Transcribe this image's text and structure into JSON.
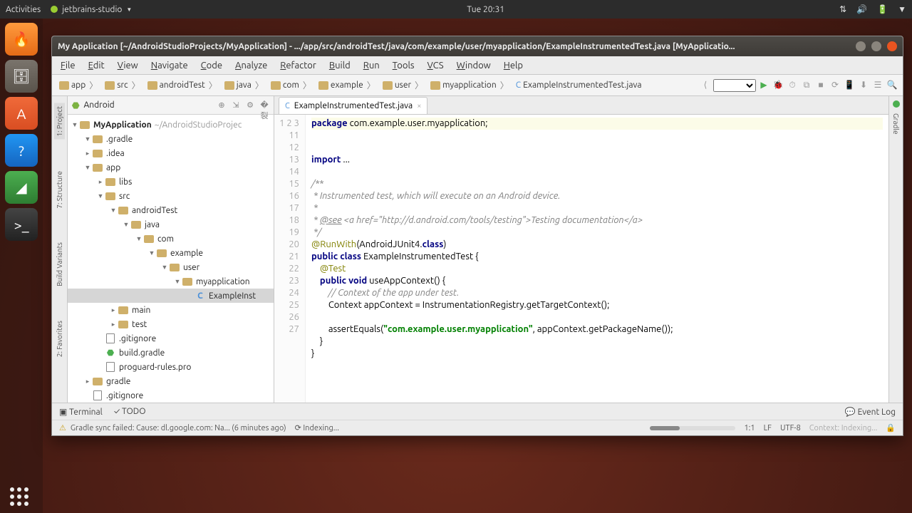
{
  "ubuntu": {
    "activities": "Activities",
    "app": "jetbrains-studio",
    "clock": "Tue 20:31"
  },
  "ide": {
    "title": "My Application [~/AndroidStudioProjects/MyApplication] - .../app/src/androidTest/java/com/example/user/myapplication/ExampleInstrumentedTest.java [MyApplicatio...",
    "menu": [
      "File",
      "Edit",
      "View",
      "Navigate",
      "Code",
      "Analyze",
      "Refactor",
      "Build",
      "Run",
      "Tools",
      "VCS",
      "Window",
      "Help"
    ],
    "breadcrumbs": [
      "app",
      "src",
      "androidTest",
      "java",
      "com",
      "example",
      "user",
      "myapplication",
      "ExampleInstrumentedTest.java"
    ],
    "left_tabs": {
      "project": "1: Project",
      "structure": "7: Structure",
      "variants": "Build Variants",
      "favorites": "2: Favorites"
    },
    "right_tab": "Gradle",
    "project_panel": {
      "title": "Android"
    },
    "tree": {
      "root": "MyApplication",
      "root_path": "~/AndroidStudioProjec",
      "items": [
        {
          "d": 1,
          "open": true,
          "t": ".gradle",
          "k": "fold"
        },
        {
          "d": 1,
          "open": false,
          "t": ".idea",
          "k": "fold"
        },
        {
          "d": 1,
          "open": true,
          "t": "app",
          "k": "fold"
        },
        {
          "d": 2,
          "open": false,
          "t": "libs",
          "k": "fold"
        },
        {
          "d": 2,
          "open": true,
          "t": "src",
          "k": "fold"
        },
        {
          "d": 3,
          "open": true,
          "t": "androidTest",
          "k": "fold"
        },
        {
          "d": 4,
          "open": true,
          "t": "java",
          "k": "fold"
        },
        {
          "d": 5,
          "open": true,
          "t": "com",
          "k": "fold"
        },
        {
          "d": 6,
          "open": true,
          "t": "example",
          "k": "fold"
        },
        {
          "d": 7,
          "open": true,
          "t": "user",
          "k": "fold"
        },
        {
          "d": 8,
          "open": true,
          "t": "myapplication",
          "k": "fold"
        },
        {
          "d": 9,
          "open": false,
          "t": "ExampleInst",
          "k": "cls",
          "sel": true
        },
        {
          "d": 3,
          "open": false,
          "t": "main",
          "k": "fold",
          "ar": "r"
        },
        {
          "d": 3,
          "open": false,
          "t": "test",
          "k": "fold",
          "ar": "r"
        },
        {
          "d": 2,
          "open": false,
          "t": ".gitignore",
          "k": "file"
        },
        {
          "d": 2,
          "open": false,
          "t": "build.gradle",
          "k": "gradle"
        },
        {
          "d": 2,
          "open": false,
          "t": "proguard-rules.pro",
          "k": "file"
        },
        {
          "d": 1,
          "open": false,
          "t": "gradle",
          "k": "fold",
          "ar": "r"
        },
        {
          "d": 1,
          "open": false,
          "t": ".gitignore",
          "k": "file"
        }
      ]
    },
    "editor_tab": "ExampleInstrumentedTest.java",
    "gutter_lines": [
      "1",
      "2",
      "3",
      "11",
      "12",
      "13",
      "14",
      "15",
      "16",
      "17",
      "18",
      "19",
      "20",
      "21",
      "22",
      "23",
      "24",
      "25",
      "26",
      "27"
    ],
    "bottom": {
      "terminal": "Terminal",
      "todo": "TODO",
      "eventlog": "Event Log"
    },
    "status": {
      "msg": "Gradle sync failed: Cause: dl.google.com: Na... (6 minutes ago)",
      "indexing": "Indexing...",
      "pos": "1:1",
      "lf": "LF",
      "enc": "UTF-8",
      "ctx": "Context: Indexing..."
    }
  }
}
